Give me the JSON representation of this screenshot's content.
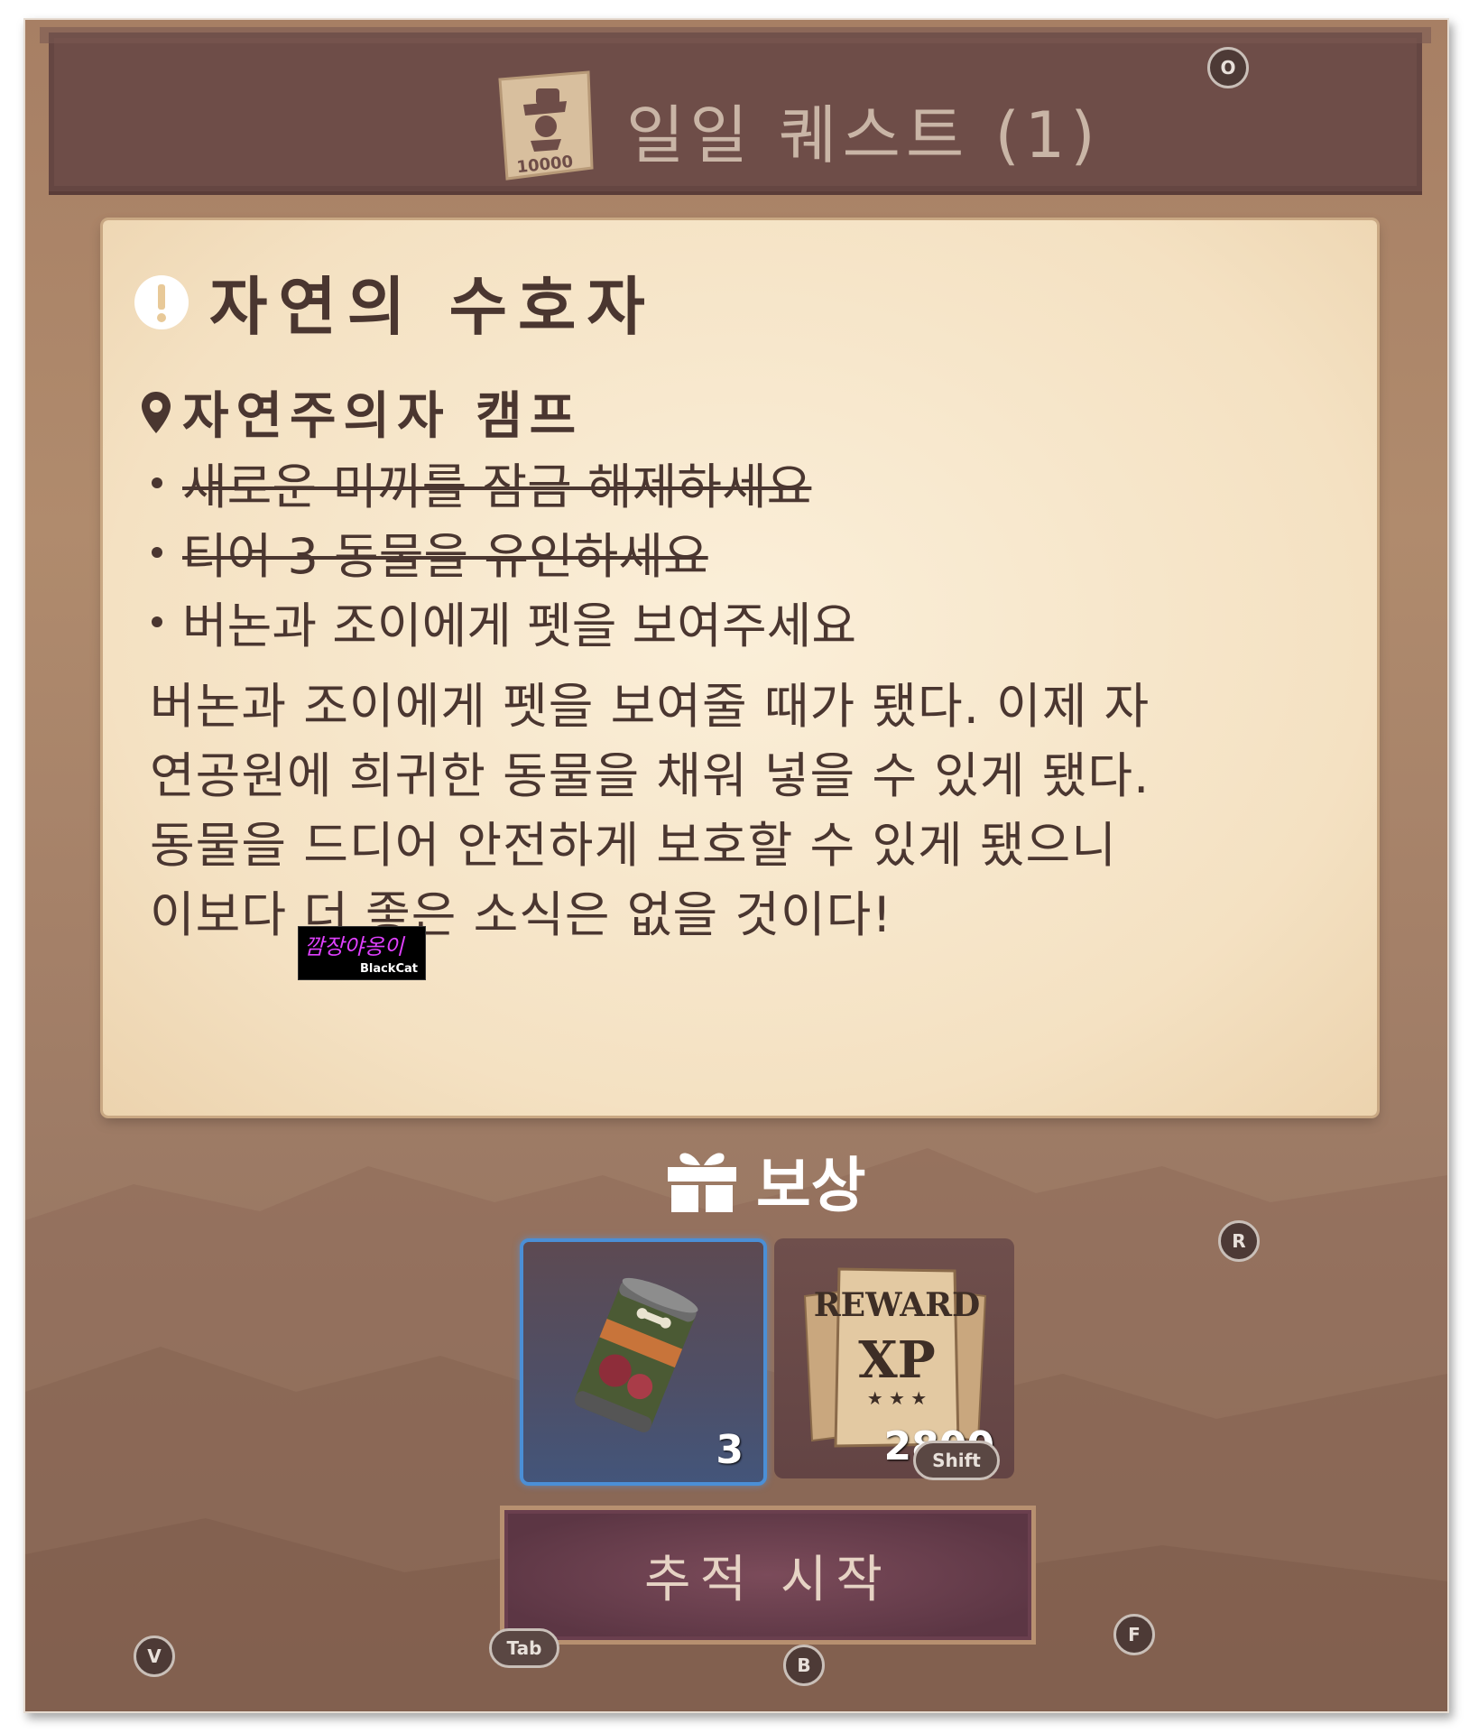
{
  "header": {
    "title": "일일 퀘스트 (1)",
    "icon": "bounty-poster-icon",
    "icon_number": "10000"
  },
  "quest": {
    "title": "자연의 수호자",
    "alert_icon": "exclamation-icon",
    "location": "자연주의자 캠프",
    "objectives": [
      {
        "text": "새로운 미끼를 잠금 해제하세요",
        "completed": true
      },
      {
        "text": "티어 3 동물을 유인하세요",
        "completed": true
      },
      {
        "text": "버논과 조이에게 펫을 보여주세요",
        "completed": false
      }
    ],
    "description_lines": [
      "버논과 조이에게 펫을 보여줄 때가 됐다. 이제 자",
      "연공원에 희귀한 동물을 채워 넣을 수 있게 됐다.",
      "동물을 드디어 안전하게 보호할 수 있게 됐으니",
      "이보다 더 좋은 소식은 없을 것이다!"
    ]
  },
  "watermark": {
    "top": "깜장야옹이",
    "bottom": "BlackCat"
  },
  "reward": {
    "label": "보상",
    "items": [
      {
        "name": "canned-food",
        "count": "3"
      },
      {
        "name": "reward-xp-poster",
        "count": "2800",
        "poster_text": "REWARD",
        "poster_sub": "XP"
      }
    ]
  },
  "track_button": {
    "label": "추적 시작"
  },
  "key_hints": {
    "o": "O",
    "r": "R",
    "shift": "Shift",
    "v": "V",
    "tab": "Tab",
    "b": "B",
    "f": "F"
  },
  "colors": {
    "header_bg": "#6e4d48",
    "parchment": "#f4e1c2",
    "text_dark": "#4a3630",
    "slot_highlight": "#4b8fd6",
    "button_bg": "#5c3644"
  }
}
